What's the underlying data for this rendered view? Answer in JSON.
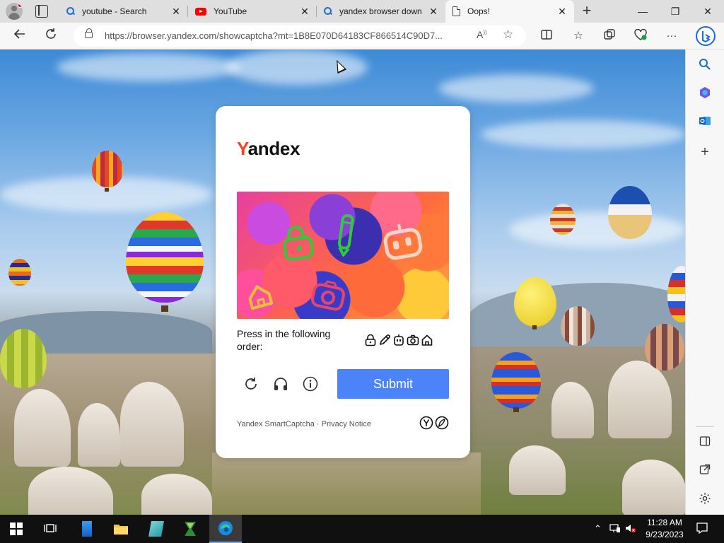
{
  "browser": {
    "tabs": [
      {
        "title": "youtube - Search",
        "icon": "search-icon",
        "active": false
      },
      {
        "title": "YouTube",
        "icon": "youtube-icon",
        "active": false
      },
      {
        "title": "yandex browser down",
        "icon": "search-icon",
        "active": false
      },
      {
        "title": "Oops!",
        "icon": "page-icon",
        "active": true
      }
    ],
    "url": "https://browser.yandex.com/showcaptcha?mt=1B8E070D64183CF866514C90D7...",
    "window_controls": {
      "minimize": "—",
      "restore": "❐",
      "close": "✕"
    }
  },
  "captcha": {
    "logo_first_letter": "Y",
    "logo_rest": "andex",
    "prompt": "Press in the following order:",
    "order_icons": [
      "lock-icon",
      "pencil-icon",
      "robot-icon",
      "camera-icon",
      "house-icon"
    ],
    "submit_label": "Submit",
    "footer_brand": "Yandex SmartCaptcha",
    "footer_separator": "·",
    "footer_link": "Privacy Notice",
    "controls": [
      "refresh-icon",
      "audio-icon",
      "info-icon"
    ]
  },
  "taskbar": {
    "time": "11:28 AM",
    "date": "9/23/2023",
    "apps": [
      "start-button",
      "task-view-icon",
      "app-icon-blue",
      "file-explorer-icon",
      "app-icon-teal",
      "app-icon-green",
      "edge-icon"
    ]
  },
  "colors": {
    "submit": "#4b84f8",
    "yandex_red": "#fc3f1d",
    "taskbar": "#101010",
    "sidebar_bg": "#f7f7f7"
  }
}
